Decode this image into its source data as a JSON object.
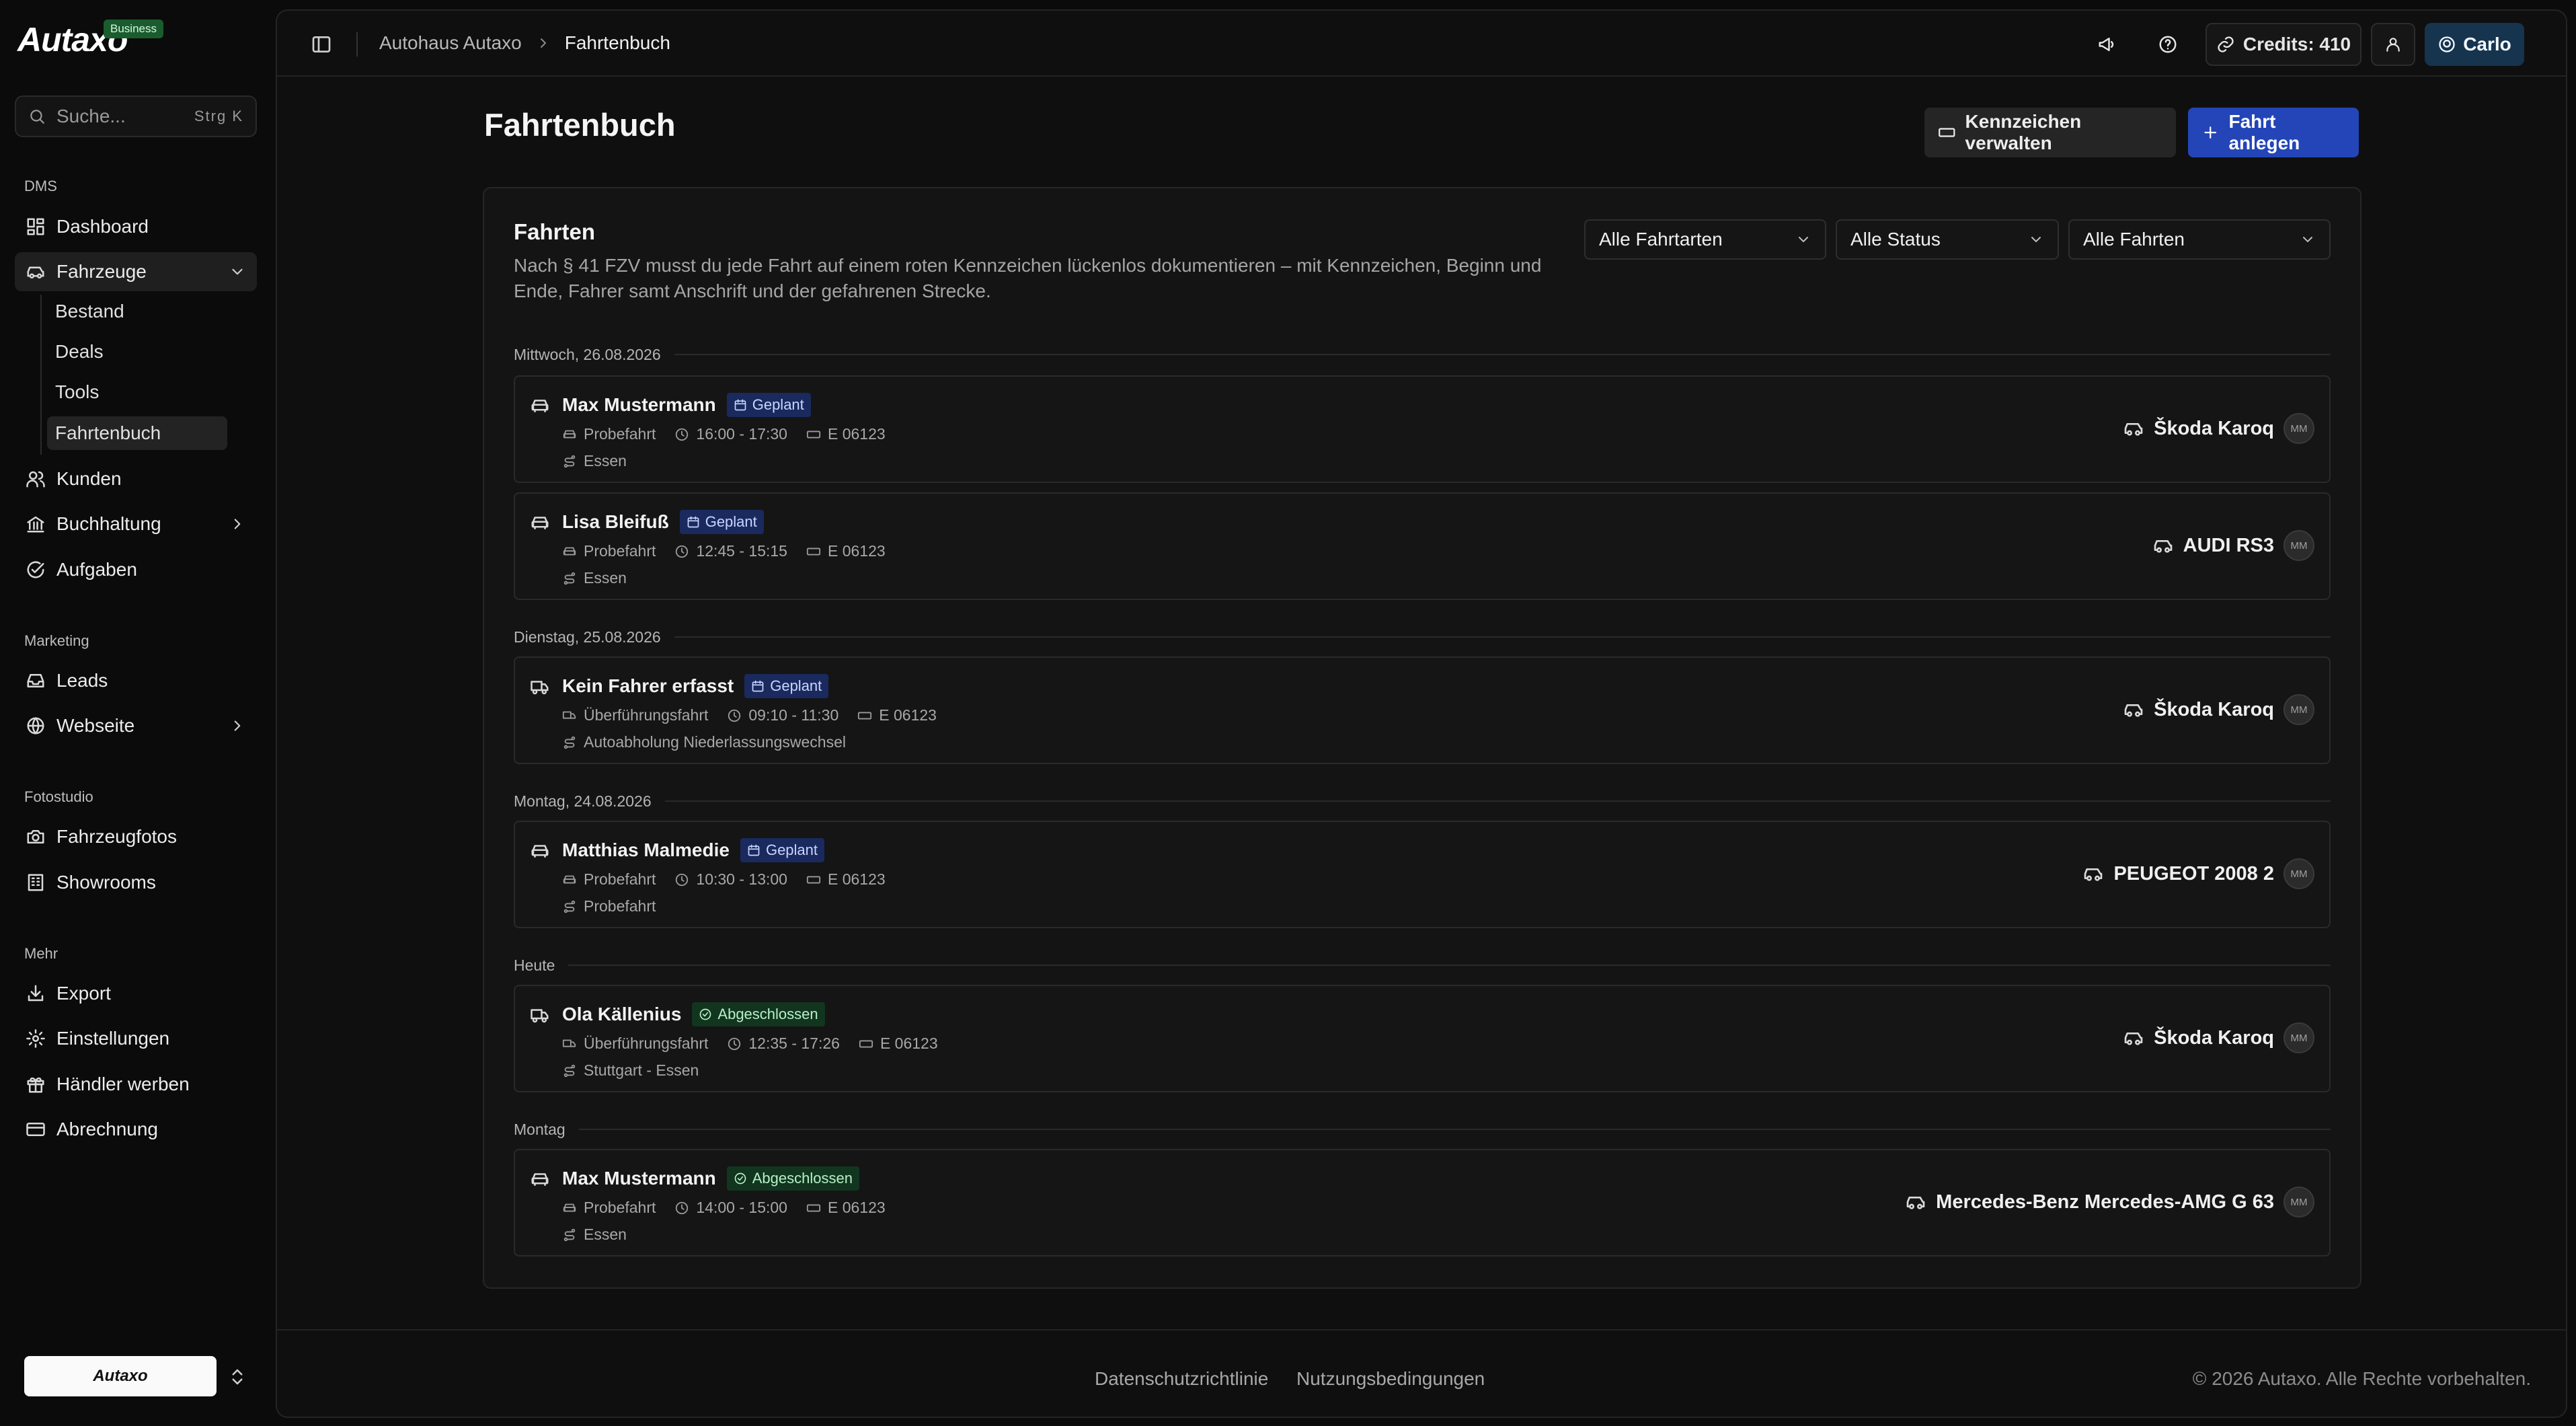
{
  "brand": {
    "name": "Autaxo",
    "badge": "Business"
  },
  "search": {
    "placeholder": "Suche...",
    "shortcut": "Strg  K"
  },
  "sidebar": {
    "sections": {
      "dms": "DMS",
      "marketing": "Marketing",
      "fotostudio": "Fotostudio",
      "mehr": "Mehr"
    },
    "items": {
      "dashboard": "Dashboard",
      "fahrzeuge": "Fahrzeuge",
      "kunden": "Kunden",
      "buchhaltung": "Buchhaltung",
      "aufgaben": "Aufgaben",
      "leads": "Leads",
      "webseite": "Webseite",
      "fahrzeugfotos": "Fahrzeugfotos",
      "showrooms": "Showrooms",
      "export": "Export",
      "einstellungen": "Einstellungen",
      "haendler": "Händler werben",
      "abrechnung": "Abrechnung"
    },
    "subitems": {
      "bestand": "Bestand",
      "deals": "Deals",
      "tools": "Tools",
      "fahrtenbuch": "Fahrtenbuch"
    },
    "footer_logo": "Autaxo"
  },
  "topbar": {
    "breadcrumb": [
      "Autohaus Autaxo",
      "Fahrtenbuch"
    ],
    "credits": "Credits: 410",
    "user": "Carlo"
  },
  "page": {
    "title": "Fahrtenbuch",
    "plates_button": "Kennzeichen verwalten",
    "new_button": "Fahrt anlegen"
  },
  "card": {
    "title": "Fahrten",
    "description": "Nach § 41 FZV musst du jede Fahrt auf einem roten Kennzeichen lückenlos dokumentieren – mit Kennzeichen, Beginn und Ende, Fahrer samt Anschrift und der gefahrenen Strecke.",
    "filters": {
      "type": "Alle Fahrtarten",
      "status": "Alle Status",
      "trips": "Alle Fahrten"
    }
  },
  "groups": [
    {
      "date": "Mittwoch, 26.08.2026"
    },
    {
      "date": "Dienstag, 25.08.2026"
    },
    {
      "date": "Montag, 24.08.2026"
    },
    {
      "date": "Heute"
    },
    {
      "date": "Montag"
    }
  ],
  "trips": [
    {
      "driver": "Max Mustermann",
      "status": "Geplant",
      "type": "Probefahrt",
      "time": "16:00 - 17:30",
      "plate": "E 06123",
      "route": "Essen",
      "car": "Škoda Karoq",
      "initials": "MM"
    },
    {
      "driver": "Lisa Bleifuß",
      "status": "Geplant",
      "type": "Probefahrt",
      "time": "12:45 - 15:15",
      "plate": "E 06123",
      "route": "Essen",
      "car": "AUDI RS3",
      "initials": "MM"
    },
    {
      "driver": "Kein Fahrer erfasst",
      "status": "Geplant",
      "type": "Überführungsfahrt",
      "time": "09:10 - 11:30",
      "plate": "E 06123",
      "route": "Autoabholung Niederlassungswechsel",
      "car": "Škoda Karoq",
      "initials": "MM"
    },
    {
      "driver": "Matthias Malmedie",
      "status": "Geplant",
      "type": "Probefahrt",
      "time": "10:30 - 13:00",
      "plate": "E 06123",
      "route": "Probefahrt",
      "car": "PEUGEOT 2008 2",
      "initials": "MM"
    },
    {
      "driver": "Ola Källenius",
      "status": "Abgeschlossen",
      "type": "Überführungsfahrt",
      "time": "12:35 - 17:26",
      "plate": "E 06123",
      "route": "Stuttgart - Essen",
      "car": "Škoda Karoq",
      "initials": "MM"
    },
    {
      "driver": "Max Mustermann",
      "status": "Abgeschlossen",
      "type": "Probefahrt",
      "time": "14:00 - 15:00",
      "plate": "E 06123",
      "route": "Essen",
      "car": "Mercedes-Benz Mercedes-AMG G 63",
      "initials": "MM"
    }
  ],
  "footer": {
    "privacy": "Datenschutzrichtlinie",
    "terms": "Nutzungsbedingungen",
    "copyright": "© 2026 Autaxo. Alle Rechte vorbehalten."
  },
  "colors": {
    "accent": "#2345b8",
    "planned_badge": "#1a2a5e",
    "done_badge": "#12351f",
    "user_button": "#17344e"
  }
}
